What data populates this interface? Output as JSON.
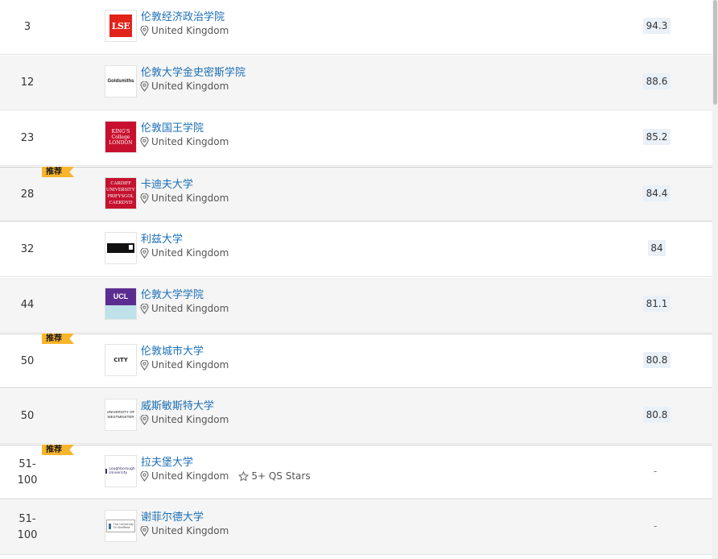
{
  "badge_label": "推荐",
  "rows": [
    {
      "rank": "3",
      "name": "伦敦经济政治学院",
      "location": "United Kingdom",
      "score": "94.3",
      "featured": false,
      "logo": "lse",
      "logo_text": "LSE"
    },
    {
      "rank": "12",
      "name": "伦敦大学金史密斯学院",
      "location": "United Kingdom",
      "score": "88.6",
      "featured": false,
      "logo": "goldsmiths",
      "logo_text": "Goldsmiths"
    },
    {
      "rank": "23",
      "name": "伦敦国王学院",
      "location": "United Kingdom",
      "score": "85.2",
      "featured": false,
      "logo": "kings",
      "logo_text": "KING'S College LONDON"
    },
    {
      "rank": "28",
      "name": "卡迪夫大学",
      "location": "United Kingdom",
      "score": "84.4",
      "featured": true,
      "logo": "cardiff",
      "logo_text": "CARDIFF UNIVERSITY PRIFYSGOL CAERDYD"
    },
    {
      "rank": "32",
      "name": "利兹大学",
      "location": "United Kingdom",
      "score": "84",
      "featured": false,
      "logo": "leeds",
      "logo_text": ""
    },
    {
      "rank": "44",
      "name": "伦敦大学学院",
      "location": "United Kingdom",
      "score": "81.1",
      "featured": false,
      "logo": "ucl",
      "logo_text": "UCL"
    },
    {
      "rank": "50",
      "name": "伦敦城市大学",
      "location": "United Kingdom",
      "score": "80.8",
      "featured": true,
      "logo": "city",
      "logo_text": "CITY"
    },
    {
      "rank": "50",
      "name": "威斯敏斯特大学",
      "location": "United Kingdom",
      "score": "80.8",
      "featured": false,
      "logo": "westminster",
      "logo_text": "UNIVERSITY OF WESTMINSTER"
    },
    {
      "rank": "51-100",
      "name": "拉夫堡大学",
      "location": "United Kingdom",
      "score": "-",
      "featured": true,
      "logo": "loughborough",
      "logo_text": "Loughborough University",
      "stars": "5+ QS Stars"
    },
    {
      "rank": "51-100",
      "name": "谢菲尔德大学",
      "location": "United Kingdom",
      "score": "-",
      "featured": false,
      "logo": "sheffield",
      "logo_text": "The University Of Sheffield"
    }
  ],
  "colors": {
    "link": "#1a6eb5",
    "badge": "#f7b52c",
    "score_bg": "#eaf0f7",
    "row_alt": "#f5f5f5"
  }
}
